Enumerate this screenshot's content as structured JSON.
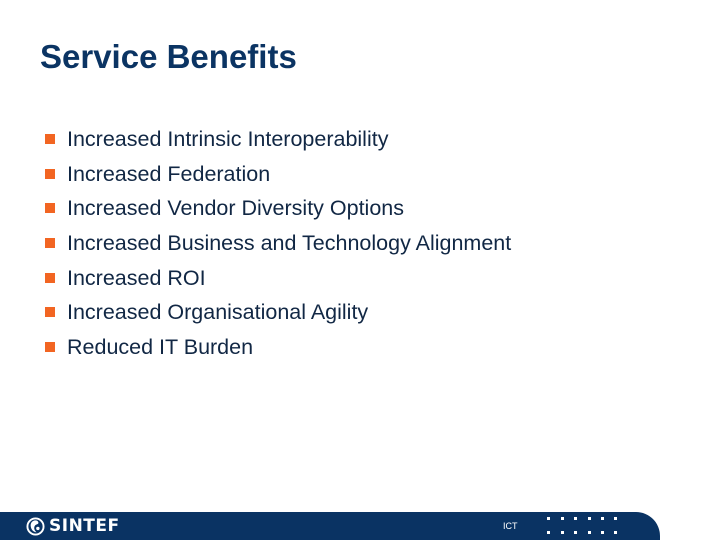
{
  "slide": {
    "title": "Service Benefits",
    "bullets": [
      {
        "label": "Increased Intrinsic Interoperability"
      },
      {
        "label": "Increased Federation"
      },
      {
        "label": "Increased Vendor Diversity Options"
      },
      {
        "label": "Increased Business and Technology Alignment"
      },
      {
        "label": "Increased ROI"
      },
      {
        "label": "Increased Organisational Agility"
      },
      {
        "label": "Reduced IT Burden"
      }
    ]
  },
  "footer": {
    "logo_text": "SINTEF",
    "logo_icon": "sintef-logo-icon",
    "department": "ICT"
  },
  "colors": {
    "title": "#0b3463",
    "bullet_marker": "#f26522",
    "footer_bar": "#0a3363",
    "text": "#112744"
  }
}
